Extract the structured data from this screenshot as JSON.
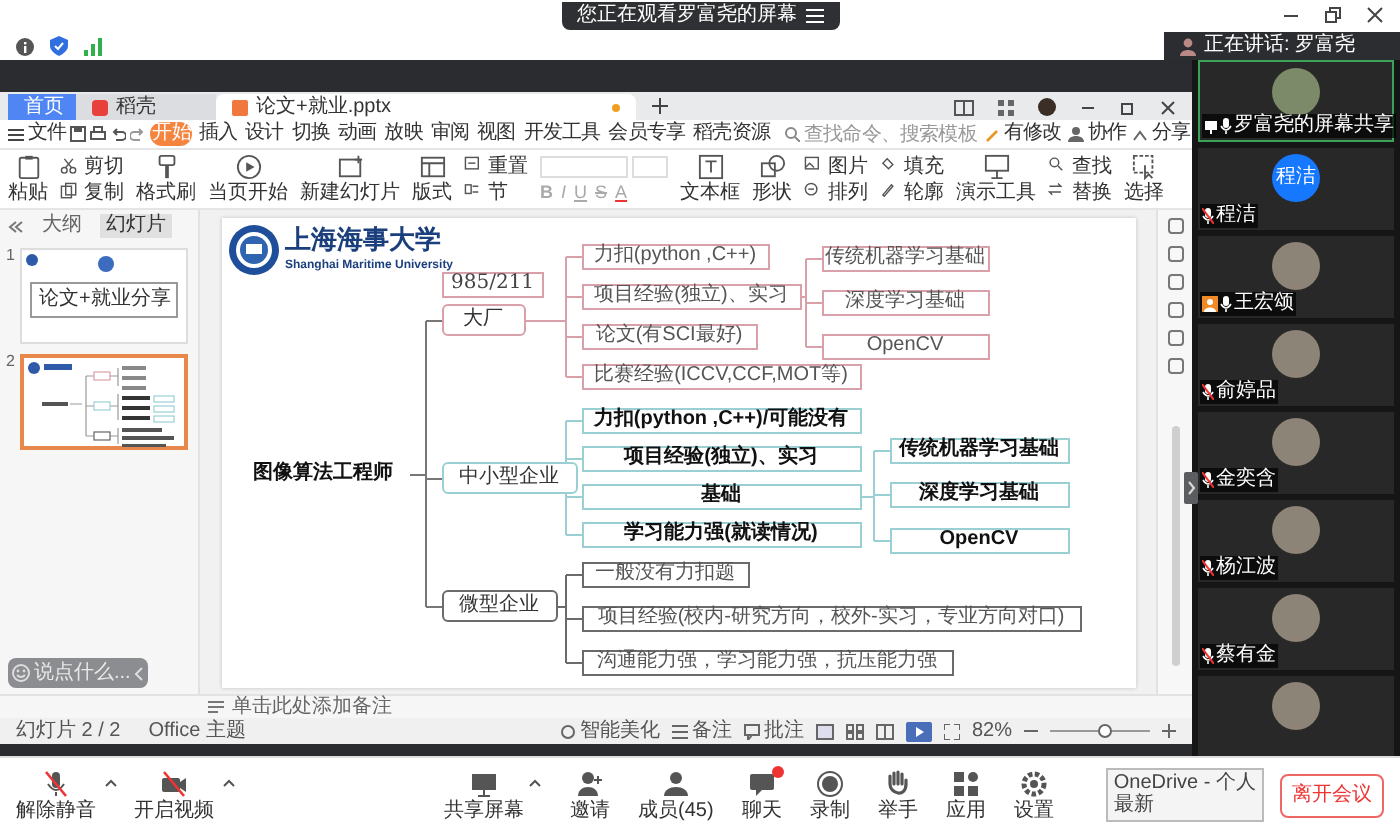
{
  "banner": {
    "text": "您正在观看罗富尧的屏幕"
  },
  "speaking": {
    "text": "正在讲话: 罗富尧"
  },
  "doc_tabs": [
    {
      "label": "首页",
      "kind": "home",
      "selected": false,
      "modified": false
    },
    {
      "label": "稻壳",
      "kind": "store",
      "selected": false,
      "modified": false
    },
    {
      "label": "论文+就业.pptx",
      "kind": "file",
      "selected": true,
      "modified": true
    }
  ],
  "menu": {
    "file": "文件",
    "items": [
      {
        "label": "开始",
        "selected": true
      },
      {
        "label": "插入",
        "selected": false
      },
      {
        "label": "设计",
        "selected": false
      },
      {
        "label": "切换",
        "selected": false
      },
      {
        "label": "动画",
        "selected": false
      },
      {
        "label": "放映",
        "selected": false
      },
      {
        "label": "审阅",
        "selected": false
      },
      {
        "label": "视图",
        "selected": false
      },
      {
        "label": "开发工具",
        "selected": false
      },
      {
        "label": "会员专享",
        "selected": false
      },
      {
        "label": "稻壳资源",
        "selected": false
      }
    ],
    "search_placeholder": "查找命令、搜索模板",
    "actions": [
      "有修改",
      "协作",
      "分享"
    ]
  },
  "ribbon": [
    {
      "kind": "big",
      "label": "粘贴"
    },
    {
      "kind": "stack",
      "labels": [
        "剪切",
        "复制"
      ]
    },
    {
      "kind": "big",
      "label": "格式刷"
    },
    {
      "kind": "big",
      "label": "当页开始"
    },
    {
      "kind": "big",
      "label": "新建幻灯片"
    },
    {
      "kind": "big",
      "label": "版式"
    },
    {
      "kind": "stack",
      "labels": [
        "重置",
        "节"
      ]
    },
    {
      "kind": "format",
      "buttons": [
        "B",
        "I",
        "U",
        "S",
        "A"
      ]
    },
    {
      "kind": "big",
      "label": "文本框"
    },
    {
      "kind": "big",
      "label": "形状"
    },
    {
      "kind": "stack",
      "labels": [
        "图片",
        "排列"
      ]
    },
    {
      "kind": "stack",
      "labels": [
        "填充",
        "轮廓"
      ]
    },
    {
      "kind": "big",
      "label": "演示工具"
    },
    {
      "kind": "stack",
      "labels": [
        "查找",
        "替换"
      ]
    },
    {
      "kind": "big",
      "label": "选择"
    }
  ],
  "slide_panel": {
    "tabs": [
      {
        "label": "大纲",
        "selected": false
      },
      {
        "label": "幻灯片",
        "selected": true
      }
    ],
    "slides": [
      {
        "number": "1",
        "title": "论文+就业分享",
        "selected": false
      },
      {
        "number": "2",
        "selected": true
      }
    ],
    "chat_placeholder": "说点什么..."
  },
  "slide": {
    "logo": {
      "name": "上海海事大学",
      "subtitle": "Shanghai Maritime University"
    },
    "mind_map": {
      "root": "图像算法工程师",
      "branches": [
        {
          "label": "大厂",
          "tag": "985/211",
          "color": "#d9a0aa",
          "bold": false,
          "children": [
            {
              "text": "力扣(python ,C++)"
            },
            {
              "text": "项目经验(独立)、实习",
              "children": [
                {
                  "text": "传统机器学习基础"
                },
                {
                  "text": "深度学习基础"
                },
                {
                  "text": "OpenCV"
                }
              ]
            },
            {
              "text": "论文(有SCI最好)"
            },
            {
              "text": "比赛经验(ICCV,CCF,MOT等)"
            }
          ]
        },
        {
          "label": "中小型企业",
          "color": "#9ad0d4",
          "bold": true,
          "children": [
            {
              "text": "力扣(python ,C++)/可能没有"
            },
            {
              "text": "项目经验(独立)、实习"
            },
            {
              "text": "基础",
              "children": [
                {
                  "text": "传统机器学习基础"
                },
                {
                  "text": "深度学习基础"
                },
                {
                  "text": "OpenCV"
                }
              ]
            },
            {
              "text": "学习能力强(就读情况)"
            }
          ]
        },
        {
          "label": "微型企业",
          "color": "#6b6b6b",
          "bold": false,
          "children": [
            {
              "text": "一般没有力扣题"
            },
            {
              "text": "项目经验(校内-研究方向，校外-实习，专业方向对口)"
            },
            {
              "text": "沟通能力强，学习能力强，抗压能力强"
            }
          ]
        }
      ]
    }
  },
  "notes_placeholder": "单击此处添加备注",
  "status_bar": {
    "slide_count": "幻灯片 2 / 2",
    "theme": "Office 主题",
    "beautify": "智能美化",
    "notes": "备注",
    "comments": "批注",
    "zoom": "82%",
    "zoom_slider": {
      "level": 0.55
    }
  },
  "participants": [
    {
      "name": "罗富尧的屏幕共享",
      "kind": "screen",
      "muted": false,
      "host": false,
      "speaking": true
    },
    {
      "name": "程洁",
      "kind": "initials",
      "initials": "程洁",
      "muted": true,
      "host": false,
      "speaking": false
    },
    {
      "name": "王宏颂",
      "kind": "photo",
      "muted": false,
      "host": true,
      "speaking": false
    },
    {
      "name": "俞婷品",
      "kind": "photo",
      "muted": true,
      "host": false,
      "speaking": false
    },
    {
      "name": "金奕含",
      "kind": "photo",
      "muted": true,
      "host": false,
      "speaking": false
    },
    {
      "name": "杨江波",
      "kind": "photo",
      "muted": true,
      "host": false,
      "speaking": false
    },
    {
      "name": "蔡有金",
      "kind": "photo",
      "muted": true,
      "host": false,
      "speaking": false
    },
    {
      "kind": "photo",
      "speaking": false
    }
  ],
  "toolbar": {
    "left": [
      {
        "label": "解除静音",
        "kind": "mic",
        "off": true
      },
      {
        "label": "开启视频",
        "kind": "camera",
        "off": true
      }
    ],
    "center": [
      {
        "label": "共享屏幕",
        "kind": "share",
        "badge": false
      },
      {
        "label": "邀请",
        "kind": "invite",
        "badge": false
      },
      {
        "label": "成员(45)",
        "kind": "members",
        "badge": false
      },
      {
        "label": "聊天",
        "kind": "chat",
        "badge": true
      },
      {
        "label": "录制",
        "kind": "record",
        "badge": false
      },
      {
        "label": "举手",
        "kind": "hand",
        "badge": false
      },
      {
        "label": "应用",
        "kind": "apps",
        "badge": false
      },
      {
        "label": "设置",
        "kind": "settings",
        "badge": false
      }
    ],
    "tooltip": [
      "OneDrive - 个人",
      "最新"
    ],
    "leave": "离开会议"
  }
}
